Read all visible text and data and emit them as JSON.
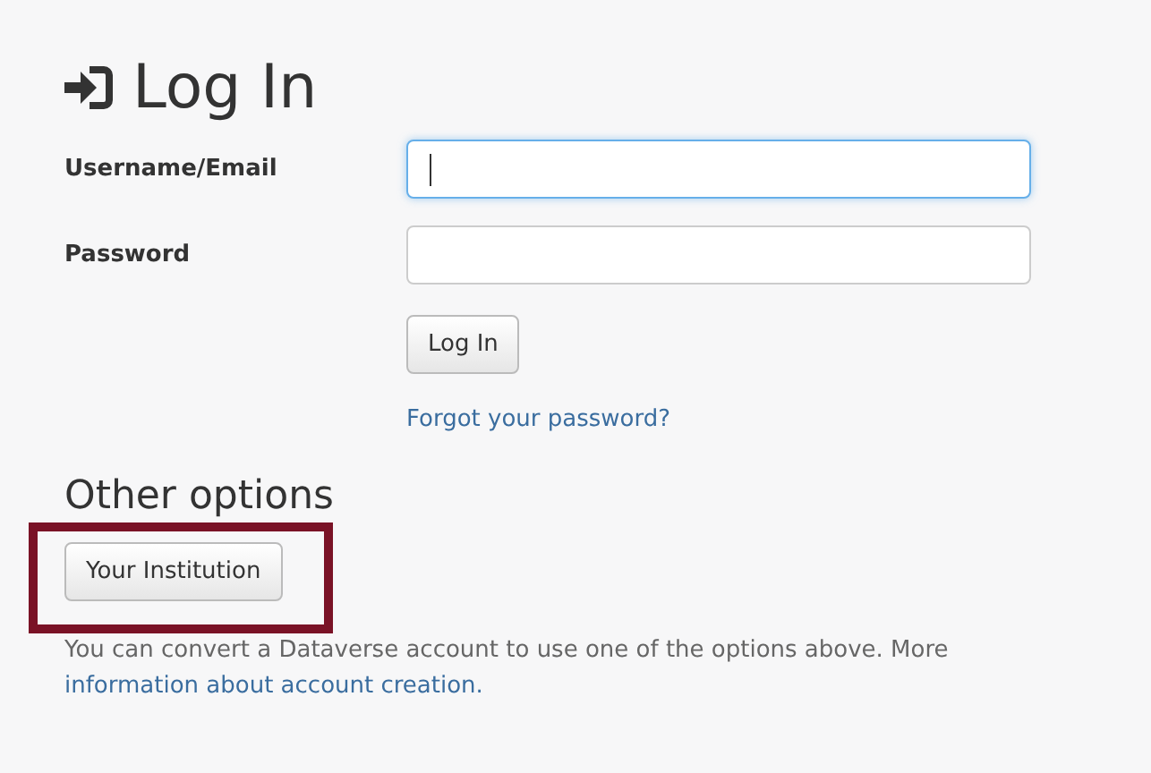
{
  "title": "Log In",
  "fields": [
    {
      "label": "Username/Email",
      "focused": true
    },
    {
      "label": "Password",
      "focused": false
    }
  ],
  "submit_button": "Log In",
  "forgot_link": "Forgot your password?",
  "other_options": {
    "heading": "Other options",
    "button": "Your Institution",
    "highlighted": true
  },
  "note": {
    "text": "You can convert a Dataverse account to use one of the options above. More",
    "link": "information about account creation."
  }
}
